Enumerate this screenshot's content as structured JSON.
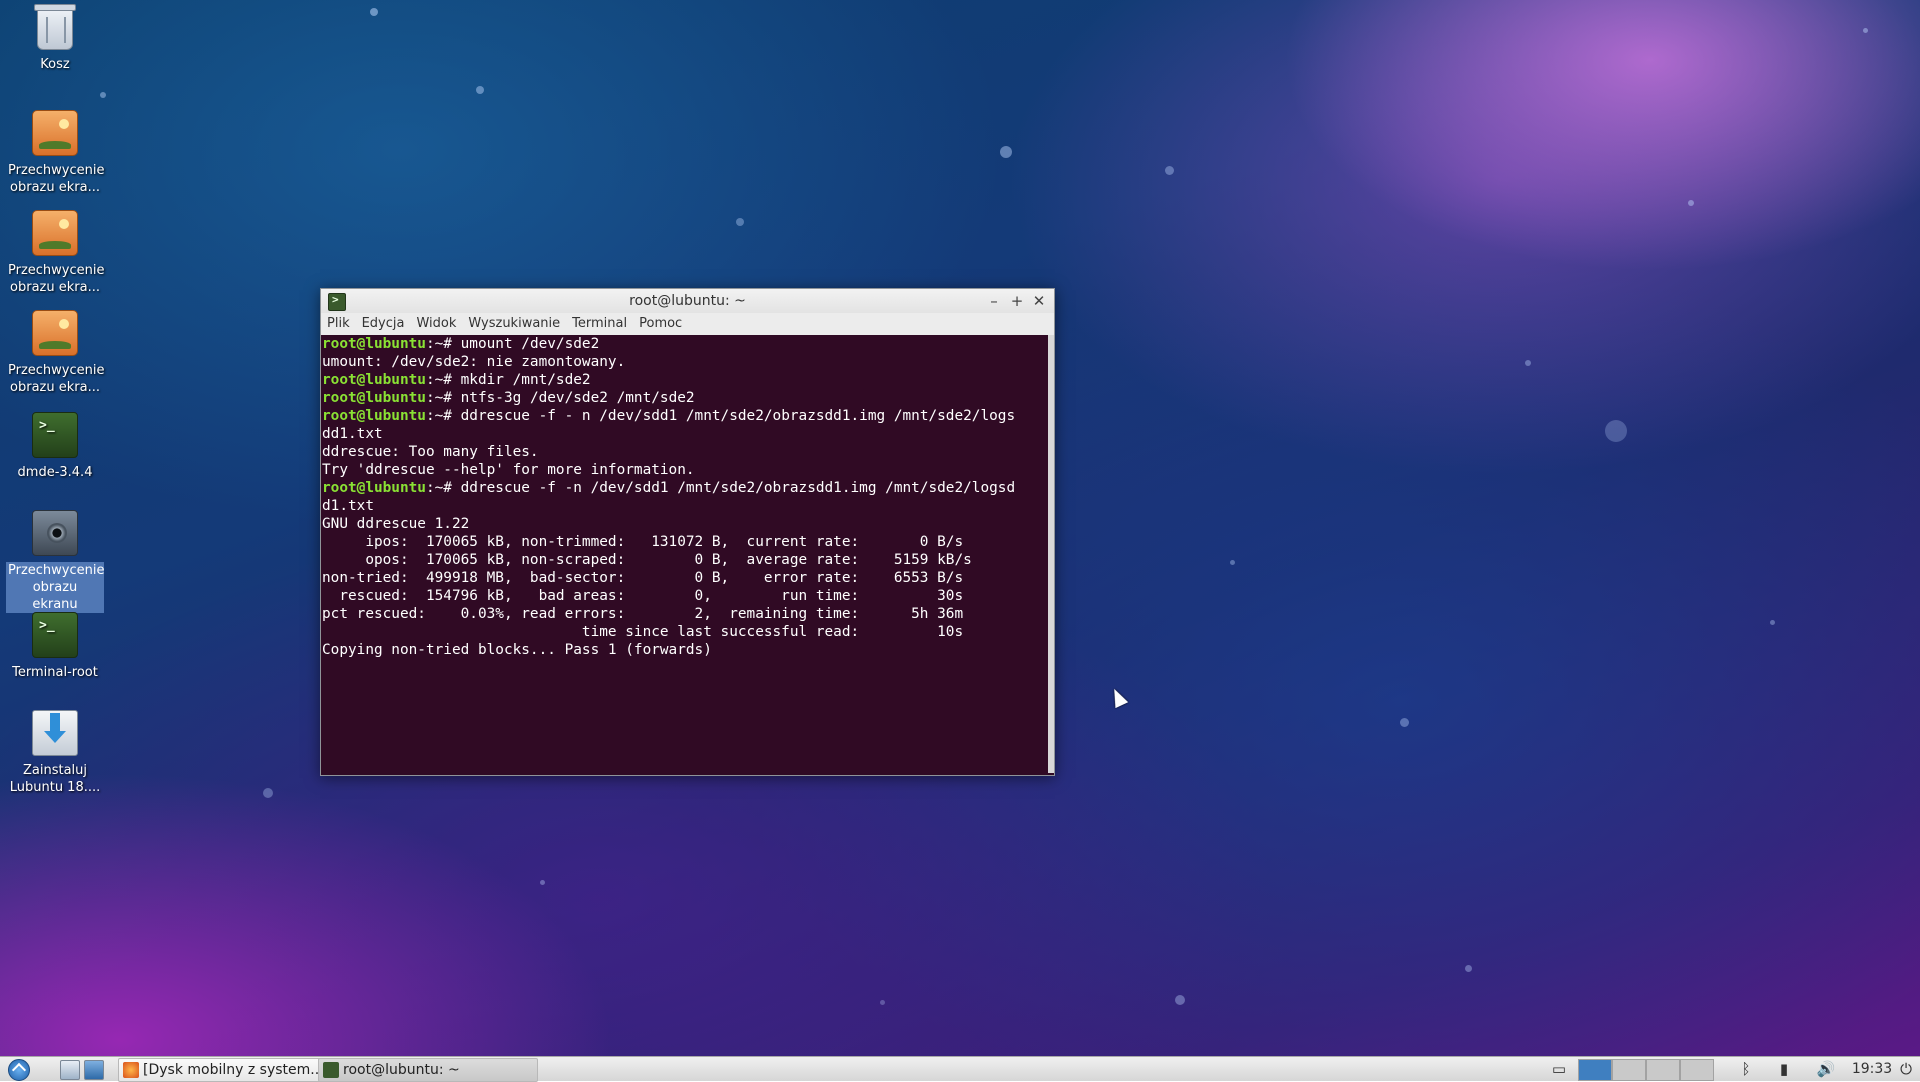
{
  "desktop_icons": [
    {
      "label": "Kosz",
      "icon": "trash-icon"
    },
    {
      "label": "Przechwycenie obrazu ekra...",
      "icon": "screenshot-file-icon"
    },
    {
      "label": "Przechwycenie obrazu ekra...",
      "icon": "screenshot-file-icon"
    },
    {
      "label": "Przechwycenie obrazu ekra...",
      "icon": "screenshot-file-icon"
    },
    {
      "label": "dmde-3.4.4",
      "icon": "terminal-icon"
    },
    {
      "label": "Przechwycenie obrazu ekranu",
      "icon": "camera-icon",
      "selected": true
    },
    {
      "label": "Terminal-root",
      "icon": "terminal-icon"
    },
    {
      "label": "Zainstaluj Lubuntu 18....",
      "icon": "install-icon"
    }
  ],
  "terminal": {
    "title": "root@lubuntu: ~",
    "buttons": {
      "minimize": "–",
      "maximize": "+",
      "close": "✕"
    },
    "menu": [
      "Plik",
      "Edycja",
      "Widok",
      "Wyszukiwanie",
      "Terminal",
      "Pomoc"
    ],
    "prompt_user": "root@lubuntu",
    "prompt_suffix": ":~#",
    "lines": [
      {
        "prompt": true,
        "text": " umount /dev/sde2"
      },
      {
        "prompt": false,
        "text": "umount: /dev/sde2: nie zamontowany."
      },
      {
        "prompt": true,
        "text": " mkdir /mnt/sde2"
      },
      {
        "prompt": true,
        "text": " ntfs-3g /dev/sde2 /mnt/sde2"
      },
      {
        "prompt": true,
        "text": " ddrescue -f - n /dev/sdd1 /mnt/sde2/obrazsdd1.img /mnt/sde2/logs"
      },
      {
        "prompt": false,
        "text": "dd1.txt"
      },
      {
        "prompt": false,
        "text": "ddrescue: Too many files."
      },
      {
        "prompt": false,
        "text": "Try 'ddrescue --help' for more information."
      },
      {
        "prompt": true,
        "text": " ddrescue -f -n /dev/sdd1 /mnt/sde2/obrazsdd1.img /mnt/sde2/logsd"
      },
      {
        "prompt": false,
        "text": "d1.txt"
      },
      {
        "prompt": false,
        "text": "GNU ddrescue 1.22"
      },
      {
        "prompt": false,
        "text": "     ipos:  170065 kB, non-trimmed:   131072 B,  current rate:       0 B/s"
      },
      {
        "prompt": false,
        "text": "     opos:  170065 kB, non-scraped:        0 B,  average rate:    5159 kB/s"
      },
      {
        "prompt": false,
        "text": "non-tried:  499918 MB,  bad-sector:        0 B,    error rate:    6553 B/s"
      },
      {
        "prompt": false,
        "text": "  rescued:  154796 kB,   bad areas:        0,        run time:         30s"
      },
      {
        "prompt": false,
        "text": "pct rescued:    0.03%, read errors:        2,  remaining time:      5h 36m"
      },
      {
        "prompt": false,
        "text": "                              time since last successful read:         10s"
      },
      {
        "prompt": false,
        "text": "Copying non-tried blocks... Pass 1 (forwards)"
      }
    ]
  },
  "taskbar": {
    "tasks": [
      {
        "label": "[Dysk mobilny z system...",
        "icon": "firefox-icon"
      },
      {
        "label": "root@lubuntu: ~",
        "icon": "terminal-icon",
        "active": true
      }
    ],
    "clock": "19:33"
  },
  "colors": {
    "terminal_bg": "#300a24",
    "prompt": "#8ae234",
    "text": "#ffffff"
  }
}
